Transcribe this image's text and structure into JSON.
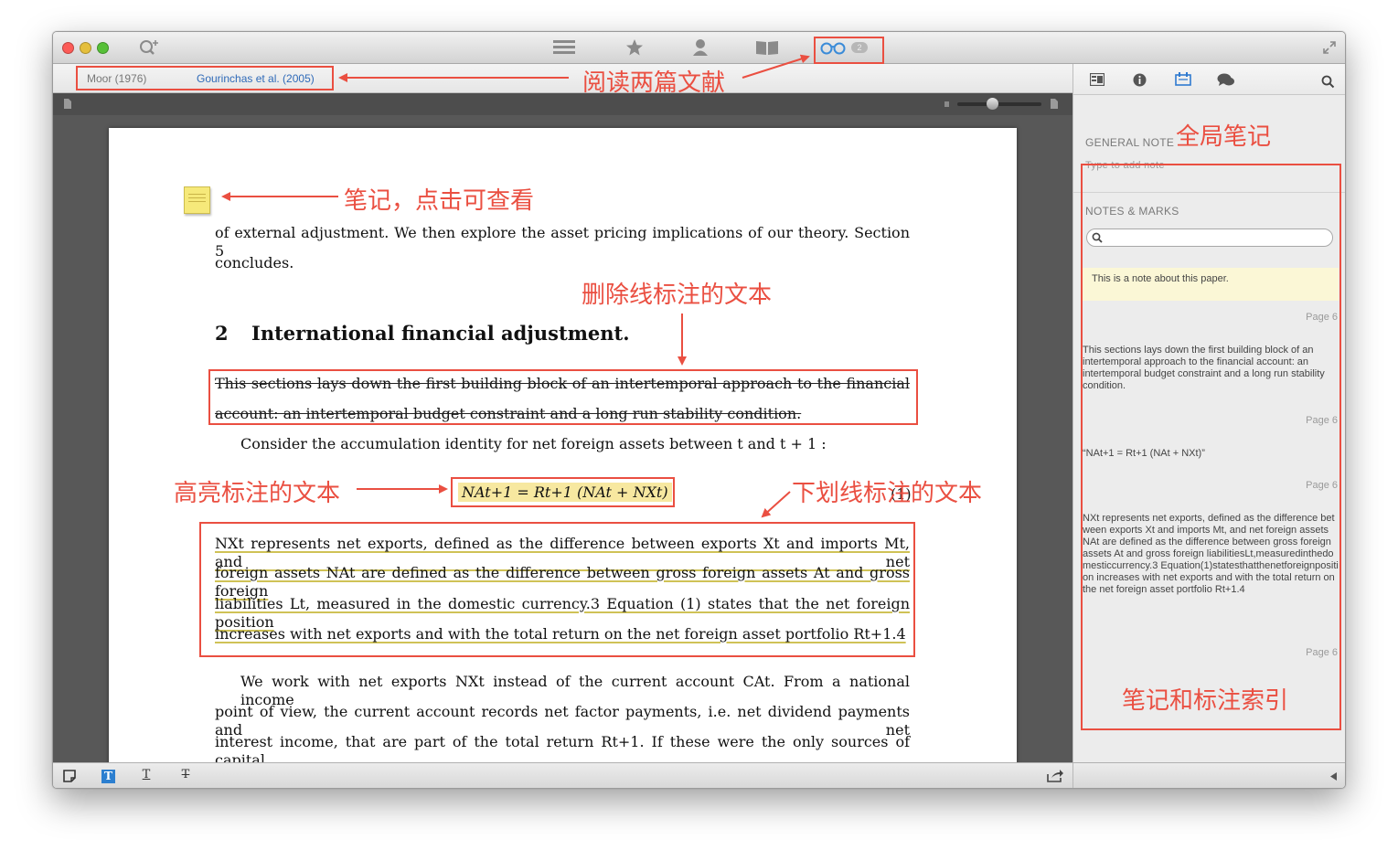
{
  "toolbar": {
    "icons": [
      "search-zoom-icon",
      "list-icon",
      "star-icon",
      "person-icon",
      "book-icon",
      "reading-glasses-icon",
      "fullscreen-icon"
    ],
    "reading_badge": "2"
  },
  "tabs": [
    {
      "label": "Moor (1976)",
      "active": false
    },
    {
      "label": "Gourinchas et al. (2005)",
      "active": true
    }
  ],
  "document": {
    "intro_line": "of external adjustment.  We then explore the asset pricing implications of our theory.  Section 5",
    "intro_line2": "concludes.",
    "section_number": "2",
    "section_title": "International financial adjustment.",
    "strike_line1": "This sections lays down the first building block of an intertemporal approach to the financial",
    "strike_line2": "account: an intertemporal budget constraint and a long run stability condition.",
    "consider_line": "Consider the accumulation identity for net foreign assets between t and t + 1 :",
    "equation": "NAt+1 = Rt+1 (NAt + NXt)",
    "equation_number": "(1)",
    "under_line1": "NXt represents net exports, defined as the difference between exports Xt and imports Mt, and net",
    "under_line2": "foreign assets NAt are defined as the difference between gross foreign assets At and gross foreign",
    "under_line3": "liabilities Lt, measured in the domestic currency.3  Equation (1) states that the net foreign position",
    "under_line4": "increases with net exports and with the total return on the net foreign asset portfolio Rt+1.4",
    "para_line1": "We work with net exports NXt instead of the current account CAt. From a national income",
    "para_line2": "point of view, the current account records net factor payments, i.e. net dividend payments and net",
    "para_line3": "interest income, that are part of the total return Rt+1.  If these were the only sources of capital"
  },
  "sidebar": {
    "general_note_label": "GENERAL NOTE",
    "general_note_placeholder": "Type to add note",
    "notes_marks_label": "NOTES & MARKS",
    "notes": [
      {
        "text": "This is a note about this paper.",
        "page": "Page 6"
      },
      {
        "text": "This sections lays down the first building block of an intertemporal approach to the financial account: an intertemporal budget constraint and a long run stability condition.",
        "page": "Page 6"
      },
      {
        "text": "“NAt+1 = Rt+1 (NAt + NXt)”",
        "page": "Page 6"
      },
      {
        "text": "NXt represents net exports, defined as the difference between exports Xt and imports Mt, and net foreign assets NAt are defined as the difference between gross foreign assets At and gross foreign liabilitiesLt,measuredinthedomesticcurrency.3 Equation(1)statesthatthenetforeignposition increases with net exports and with the total return on the net foreign asset portfolio Rt+1.4",
        "page": "Page 6"
      }
    ]
  },
  "annotations": {
    "read_two": "阅读两篇文献",
    "global_note": "全局笔记",
    "note_click": "笔记，点击可查看",
    "strike_text": "删除线标注的文本",
    "highlight_text": "高亮标注的文本",
    "underline_text": "下划线标注的文本",
    "index_text": "笔记和标注索引"
  },
  "colors": {
    "annotation": "#ea4f41",
    "highlight": "#f7e8a0",
    "underline": "#cfc256",
    "active_tab": "#2f6ab8"
  }
}
